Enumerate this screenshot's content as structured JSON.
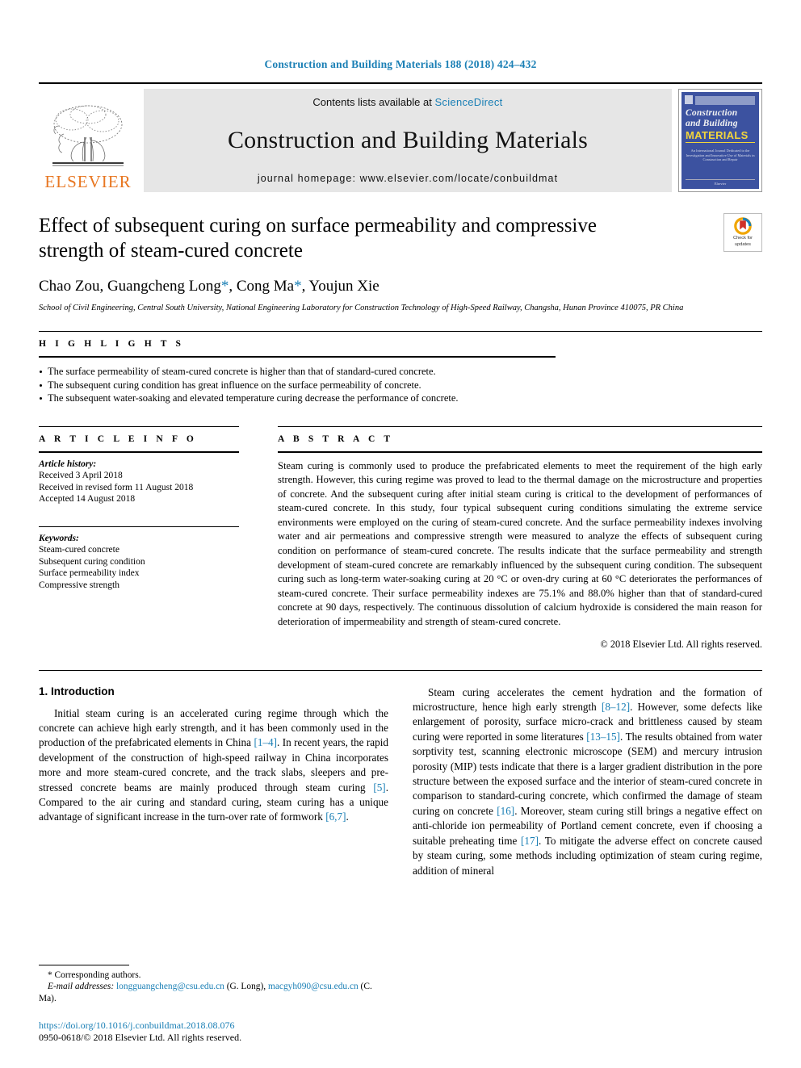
{
  "running_head": "Construction and Building Materials 188 (2018) 424–432",
  "masthead": {
    "publisher_logo_label": "ELSEVIER",
    "contents_prefix": "Contents lists available at ",
    "contents_link": "ScienceDirect",
    "journal_title": "Construction and Building Materials",
    "homepage_line": "journal homepage: www.elsevier.com/locate/conbuildmat",
    "cover": {
      "line1": "Construction",
      "line2": "and Building",
      "line3": "MATERIALS",
      "subtitle": "An International Journal Dedicated to the Investigation and Innovative Use of Materials in Construction and Repair",
      "footer": "Elsevier"
    }
  },
  "article": {
    "title": "Effect of subsequent curing on surface permeability and compressive strength of steam-cured concrete",
    "authors_parts": [
      {
        "text": "Chao Zou, Guangcheng Long",
        "type": "name"
      },
      {
        "text": "*",
        "type": "star"
      },
      {
        "text": ", Cong Ma",
        "type": "name"
      },
      {
        "text": "*",
        "type": "star"
      },
      {
        "text": ", Youjun Xie",
        "type": "name"
      }
    ],
    "authors_plain": "Chao Zou, Guangcheng Long*, Cong Ma*, Youjun Xie",
    "affiliation": "School of Civil Engineering, Central South University, National Engineering Laboratory for Construction Technology of High-Speed Railway, Changsha, Hunan Province 410075, PR China",
    "crossmark_label_line1": "Check for",
    "crossmark_label_line2": "updates"
  },
  "highlights": {
    "heading": "H I G H L I G H T S",
    "items": [
      "The surface permeability of steam-cured concrete is higher than that of standard-cured concrete.",
      "The subsequent curing condition has great influence on the surface permeability of concrete.",
      "The subsequent water-soaking and elevated temperature curing decrease the performance of concrete."
    ]
  },
  "article_info": {
    "heading": "A R T I C L E   I N F O",
    "history_label": "Article history:",
    "history": [
      "Received 3 April 2018",
      "Received in revised form 11 August 2018",
      "Accepted 14 August 2018"
    ],
    "keywords_label": "Keywords:",
    "keywords": [
      "Steam-cured concrete",
      "Subsequent curing condition",
      "Surface permeability index",
      "Compressive strength"
    ]
  },
  "abstract": {
    "heading": "A B S T R A C T",
    "text": "Steam curing is commonly used to produce the prefabricated elements to meet the requirement of the high early strength. However, this curing regime was proved to lead to the thermal damage on the microstructure and properties of concrete. And the subsequent curing after initial steam curing is critical to the development of performances of steam-cured concrete. In this study, four typical subsequent curing conditions simulating the extreme service environments were employed on the curing of steam-cured concrete. And the surface permeability indexes involving water and air permeations and compressive strength were measured to analyze the effects of subsequent curing condition on performance of steam-cured concrete. The results indicate that the surface permeability and strength development of steam-cured concrete are remarkably influenced by the subsequent curing condition. The subsequent curing such as long-term water-soaking curing at 20 °C or oven-dry curing at 60 °C deteriorates the performances of steam-cured concrete. Their surface permeability indexes are 75.1% and 88.0% higher than that of standard-cured concrete at 90 days, respectively. The continuous dissolution of calcium hydroxide is considered the main reason for deterioration of impermeability and strength of steam-cured concrete.",
    "copyright": "© 2018 Elsevier Ltd. All rights reserved."
  },
  "body": {
    "section_title": "1. Introduction",
    "left_paragraph_1_a": "Initial steam curing is an accelerated curing regime through which the concrete can achieve high early strength, and it has been commonly used in the production of the prefabricated elements in China ",
    "left_ref_1": "[1–4]",
    "left_paragraph_1_b": ". In recent years, the rapid development of the construction of high-speed railway in China incorporates more and more steam-cured concrete, and the track slabs, sleepers and pre-stressed concrete beams are mainly produced through steam curing ",
    "left_ref_2": "[5]",
    "left_paragraph_1_c": ". Compared to the air curing and standard curing, steam curing has a unique advantage of significant increase in the turn-over rate of formwork ",
    "left_ref_3": "[6,7]",
    "left_paragraph_1_d": ".",
    "right_paragraph_a": "Steam curing accelerates the cement hydration and the formation of microstructure, hence high early strength ",
    "right_ref_1": "[8–12]",
    "right_paragraph_b": ". However, some defects like enlargement of porosity, surface micro-crack and brittleness caused by steam curing were reported in some literatures ",
    "right_ref_2": "[13–15]",
    "right_paragraph_c": ". The results obtained from water sorptivity test, scanning electronic microscope (SEM) and mercury intrusion porosity (MIP) tests indicate that there is a larger gradient distribution in the pore structure between the exposed surface and the interior of steam-cured concrete in comparison to standard-curing concrete, which confirmed the damage of steam curing on concrete ",
    "right_ref_3": "[16]",
    "right_paragraph_d": ". Moreover, steam curing still brings a negative effect on anti-chloride ion permeability of Portland cement concrete, even if choosing a suitable preheating time ",
    "right_ref_4": "[17]",
    "right_paragraph_e": ". To mitigate the adverse effect on concrete caused by steam curing, some methods including optimization of steam curing regime, addition of mineral"
  },
  "footnotes": {
    "corresponding": "* Corresponding authors.",
    "email_label": "E-mail addresses:",
    "email_1": "longguangcheng@csu.edu.cn",
    "email_1_owner": " (G. Long), ",
    "email_2": "macgyh090@csu.edu.cn",
    "email_2_owner": " (C. Ma).",
    "doi": "https://doi.org/10.1016/j.conbuildmat.2018.08.076",
    "issn": "0950-0618/© 2018 Elsevier Ltd. All rights reserved."
  },
  "colors": {
    "link": "#1a7fb5",
    "elsevier_orange": "#E87722",
    "band_gray": "#e6e6e6",
    "cover_blue": "#3c52a0",
    "cover_yellow": "#f2d53c"
  }
}
